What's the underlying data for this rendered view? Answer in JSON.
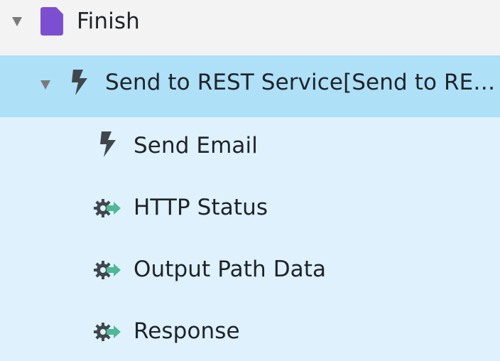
{
  "tree": {
    "root": {
      "label": "Finish",
      "expanded": true,
      "icon": "purple-document-icon",
      "icon_color": "#7b4fd0"
    },
    "selected": {
      "label": "Send to REST Service[Send to REST Service]",
      "expanded": true,
      "icon": "lightning-bolt-icon"
    },
    "children": [
      {
        "label": "Send Email",
        "icon": "lightning-bolt-icon"
      },
      {
        "label": "HTTP Status",
        "icon": "gear-output-icon"
      },
      {
        "label": "Output Path Data",
        "icon": "gear-output-icon"
      },
      {
        "label": "Response",
        "icon": "gear-output-icon"
      }
    ]
  },
  "colors": {
    "root_row_bg": "#f3f3f3",
    "selected_row_bg": "#aee0f8",
    "child_row_bg": "#def1fc",
    "text": "#1f2327",
    "icon_dark": "#3f474d",
    "arrow_green": "#4fb894"
  }
}
